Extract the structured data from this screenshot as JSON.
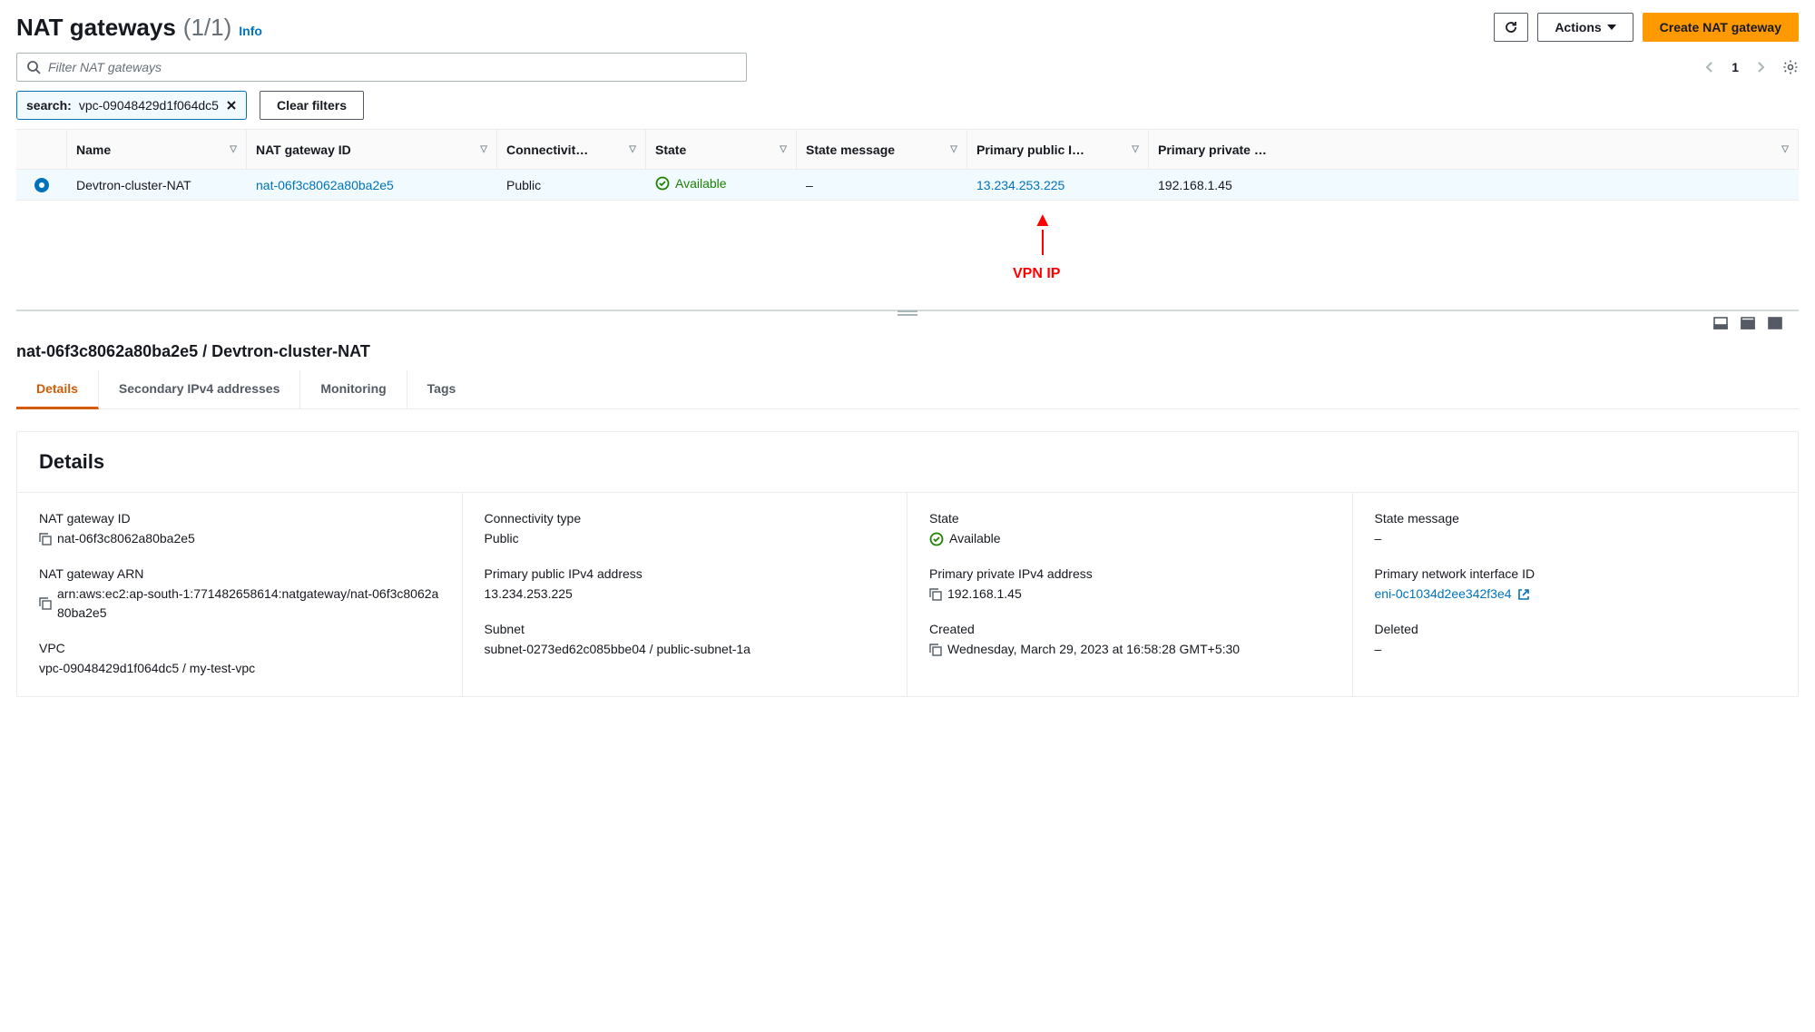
{
  "header": {
    "title": "NAT gateways",
    "count": "(1/1)",
    "info": "Info",
    "actions_label": "Actions",
    "create_label": "Create NAT gateway"
  },
  "search": {
    "placeholder": "Filter NAT gateways"
  },
  "pager": {
    "page": "1"
  },
  "chip": {
    "label": "search:",
    "value": "vpc-09048429d1f064dc5",
    "clear": "Clear filters"
  },
  "columns": {
    "name": "Name",
    "id": "NAT gateway ID",
    "connectivity": "Connectivit…",
    "state": "State",
    "state_msg": "State message",
    "pub_ip": "Primary public I…",
    "priv_ip": "Primary private …"
  },
  "row": {
    "name": "Devtron-cluster-NAT",
    "id": "nat-06f3c8062a80ba2e5",
    "connectivity": "Public",
    "state": "Available",
    "state_msg": "–",
    "pub_ip": "13.234.253.225",
    "priv_ip": "192.168.1.45"
  },
  "annotation": {
    "label": "VPN IP"
  },
  "detail": {
    "title": "nat-06f3c8062a80ba2e5 / Devtron-cluster-NAT",
    "tabs": {
      "details": "Details",
      "secondary": "Secondary IPv4 addresses",
      "monitoring": "Monitoring",
      "tags": "Tags"
    },
    "panel_title": "Details",
    "fields": {
      "nat_id_label": "NAT gateway ID",
      "nat_id_value": "nat-06f3c8062a80ba2e5",
      "arn_label": "NAT gateway ARN",
      "arn_value": "arn:aws:ec2:ap-south-1:771482658614:natgateway/nat-06f3c8062a80ba2e5",
      "vpc_label": "VPC",
      "vpc_value": "vpc-09048429d1f064dc5 / my-test-vpc",
      "conn_label": "Connectivity type",
      "conn_value": "Public",
      "pub_label": "Primary public IPv4 address",
      "pub_value": "13.234.253.225",
      "subnet_label": "Subnet",
      "subnet_value": "subnet-0273ed62c085bbe04 / public-subnet-1a",
      "state_label": "State",
      "state_value": "Available",
      "priv_label": "Primary private IPv4 address",
      "priv_value": "192.168.1.45",
      "created_label": "Created",
      "created_value": "Wednesday, March 29, 2023 at 16:58:28 GMT+5:30",
      "statemsg_label": "State message",
      "statemsg_value": "–",
      "eni_label": "Primary network interface ID",
      "eni_value": "eni-0c1034d2ee342f3e4",
      "deleted_label": "Deleted",
      "deleted_value": "–"
    }
  }
}
